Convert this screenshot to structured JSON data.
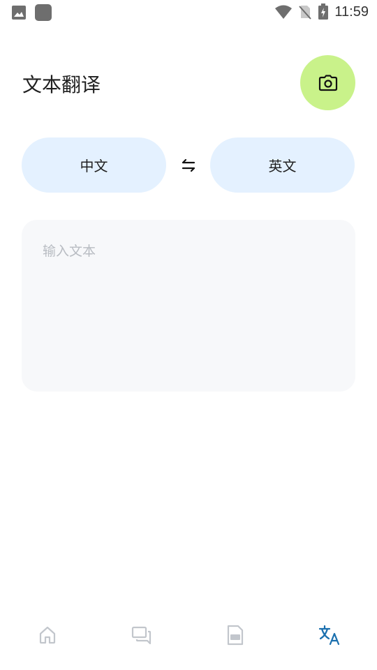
{
  "status_bar": {
    "time": "11:59",
    "icons": [
      "image-icon",
      "app-icon",
      "wifi-icon",
      "no-sim-icon",
      "battery-charging-icon"
    ]
  },
  "header": {
    "title": "文本翻译",
    "camera_icon": "camera-icon"
  },
  "language": {
    "source": "中文",
    "target": "英文",
    "swap_icon": "swap-icon"
  },
  "input": {
    "placeholder": "输入文本",
    "value": ""
  },
  "bottom_nav": {
    "items": [
      {
        "icon": "home-icon",
        "active": false
      },
      {
        "icon": "chat-icon",
        "active": false
      },
      {
        "icon": "pdf-icon",
        "active": false
      },
      {
        "icon": "translate-icon",
        "active": true
      }
    ]
  },
  "colors": {
    "accent_green": "#c9f28a",
    "pill_blue": "#e4f1ff",
    "active_nav": "#1a6fae",
    "inactive_nav": "#c2c6cc"
  }
}
